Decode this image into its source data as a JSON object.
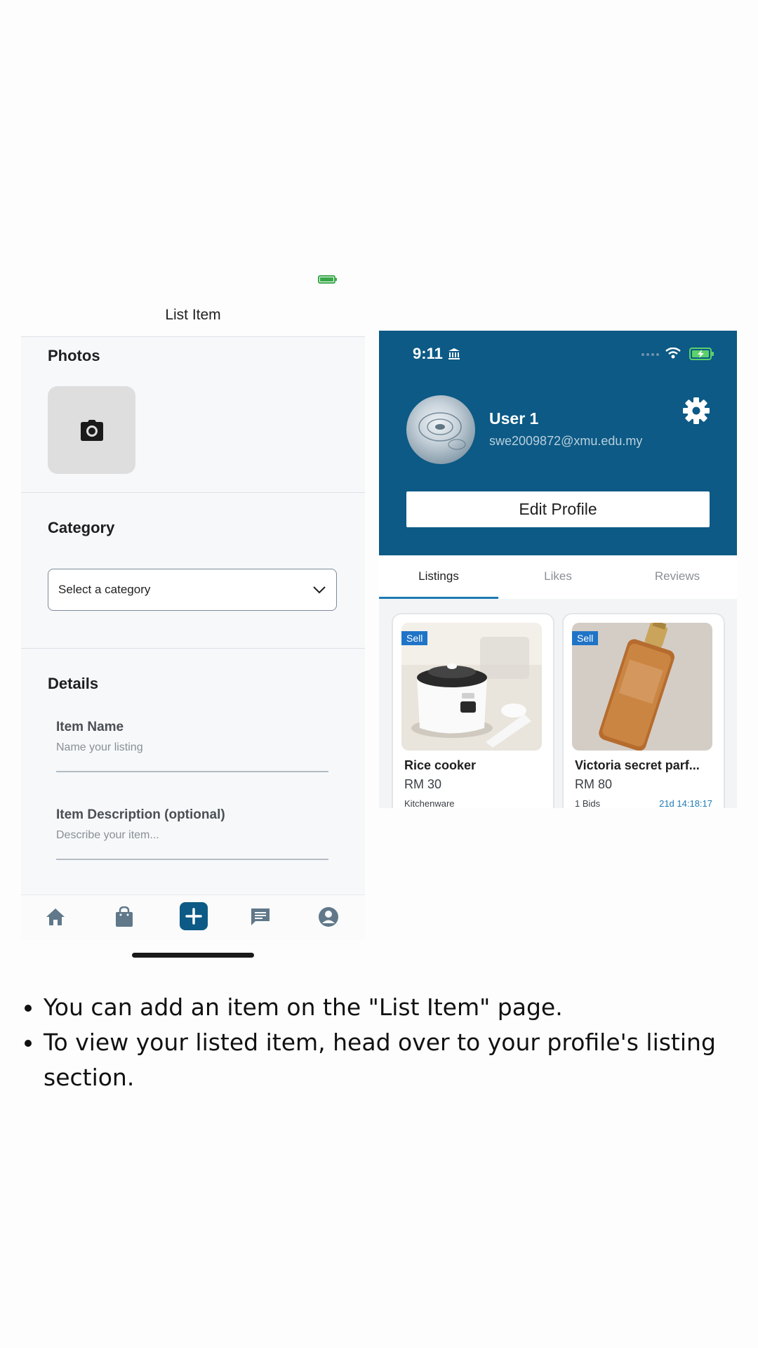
{
  "list_item": {
    "title": "List Item",
    "photos_heading": "Photos",
    "category_heading": "Category",
    "category_select": "Select a category",
    "details_heading": "Details",
    "item_name_label": "Item Name",
    "item_name_placeholder": "Name your listing",
    "item_desc_label": "Item Description (optional)",
    "item_desc_placeholder": "Describe your item...",
    "icons": [
      "camera-icon",
      "chevron-down-icon",
      "home-icon",
      "shopping-bag-icon",
      "add-icon",
      "chat-icon",
      "account-icon"
    ],
    "accent": "#0c5a85"
  },
  "profile": {
    "status_time": "9:11",
    "user_name": "User 1",
    "user_email": "swe2009872@xmu.edu.my",
    "edit_button": "Edit Profile",
    "tabs": [
      "Listings",
      "Likes",
      "Reviews"
    ],
    "header_color": "#0c5a85",
    "listings": [
      {
        "tag": "Sell",
        "title": "Rice cooker",
        "price": "RM 30",
        "meta": "Kitchenware",
        "time": ""
      },
      {
        "tag": "Sell",
        "title": "Victoria secret parf...",
        "price": "RM 80",
        "meta": "1 Bids",
        "time": "21d 14:18:17"
      }
    ]
  },
  "instructions": [
    "You can add an item on the \"List Item\" page.",
    "To view your listed item, head over to your profile's listing section."
  ]
}
